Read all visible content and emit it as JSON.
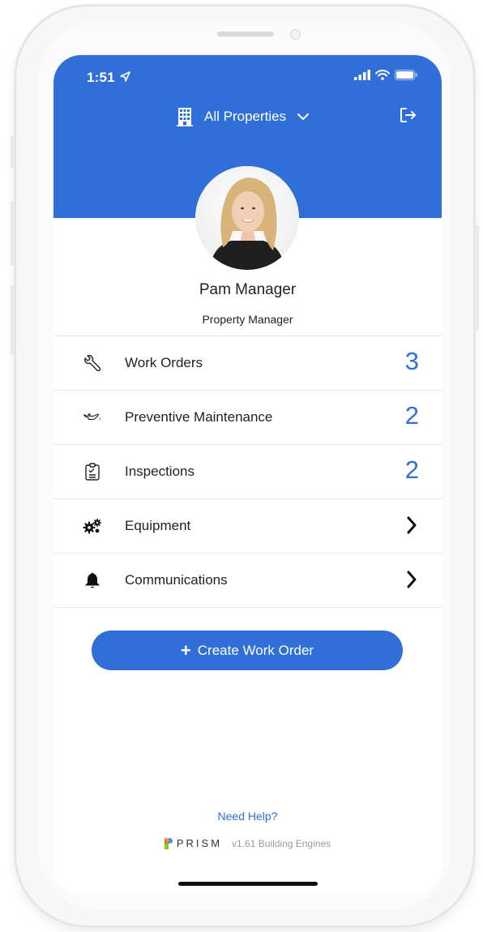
{
  "status_bar": {
    "time": "1:51"
  },
  "header": {
    "property_selector": "All Properties"
  },
  "profile": {
    "name": "Pam Manager",
    "role": "Property Manager"
  },
  "menu": [
    {
      "label": "Work Orders",
      "count": "3",
      "icon": "wrench-icon"
    },
    {
      "label": "Preventive Maintenance",
      "count": "2",
      "icon": "oil-can-icon"
    },
    {
      "label": "Inspections",
      "count": "2",
      "icon": "clipboard-icon"
    },
    {
      "label": "Equipment",
      "icon": "gears-icon"
    },
    {
      "label": "Communications",
      "icon": "bell-icon"
    }
  ],
  "actions": {
    "create_work_order": "Create Work Order",
    "create_plus": "+"
  },
  "footer": {
    "need_help": "Need Help?",
    "brand": "PRISM",
    "version": "v1.61 Building Engines"
  },
  "colors": {
    "accent": "#2f6fd7",
    "text": "#222222",
    "divider": "#e6e6e6"
  }
}
